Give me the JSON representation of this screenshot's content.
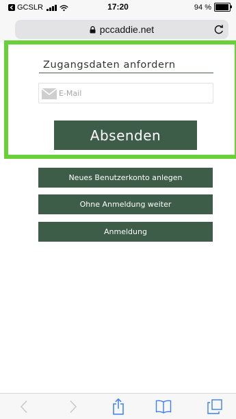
{
  "status_bar": {
    "carrier": "GCSLR",
    "time": "17:20",
    "battery_text": "94 %",
    "battery_level": 0.94
  },
  "browser": {
    "url": "pccaddie.net"
  },
  "form": {
    "title": "Zugangsdaten anfordern",
    "email_placeholder": "E-Mail",
    "submit_label": "Absenden"
  },
  "actions": [
    "Neues Benutzerkonto anlegen",
    "Ohne Anmeldung weiter",
    "Anmeldung"
  ],
  "colors": {
    "button_bg": "#3e5d49",
    "highlight": "#6ad03a",
    "browser_icons": "#3a7ff6"
  },
  "toolbar": {
    "icons": [
      "back-icon",
      "forward-icon",
      "share-icon",
      "bookmarks-icon",
      "tabs-icon"
    ]
  }
}
